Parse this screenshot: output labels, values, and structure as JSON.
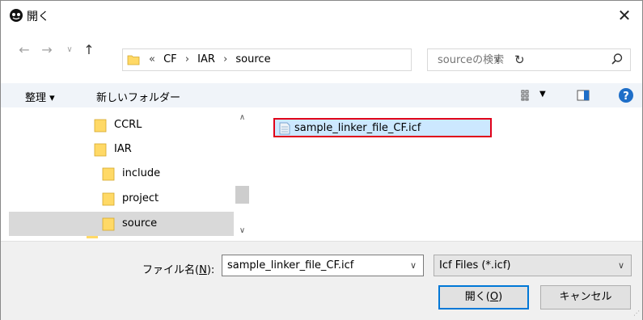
{
  "window": {
    "title": "開く",
    "close_label": "✕"
  },
  "address": {
    "breadcrumbs": [
      "«",
      "CF",
      "›",
      "IAR",
      "›",
      "source"
    ]
  },
  "search": {
    "placeholder": "sourceの検索"
  },
  "toolbar": {
    "organize_label": "整理 ▾",
    "new_folder_label": "新しいフォルダー"
  },
  "tree": {
    "items": [
      {
        "label": "CCRL"
      },
      {
        "label": "IAR"
      },
      {
        "label": "include"
      },
      {
        "label": "project"
      },
      {
        "label": "source"
      }
    ]
  },
  "files": [
    {
      "name": "sample_linker_file_CF.icf"
    }
  ],
  "filename": {
    "label_prefix": "ファイル名(",
    "label_key": "N",
    "label_suffix": "):",
    "value": "sample_linker_file_CF.icf"
  },
  "filetype": {
    "value": "Icf Files (*.icf)"
  },
  "buttons": {
    "open_prefix": "開く(",
    "open_key": "O",
    "open_suffix": ")",
    "cancel": "キャンセル"
  },
  "colors": {
    "accent": "#0078d7",
    "selection_outline": "#e0001a",
    "folder": "#ffd966"
  }
}
